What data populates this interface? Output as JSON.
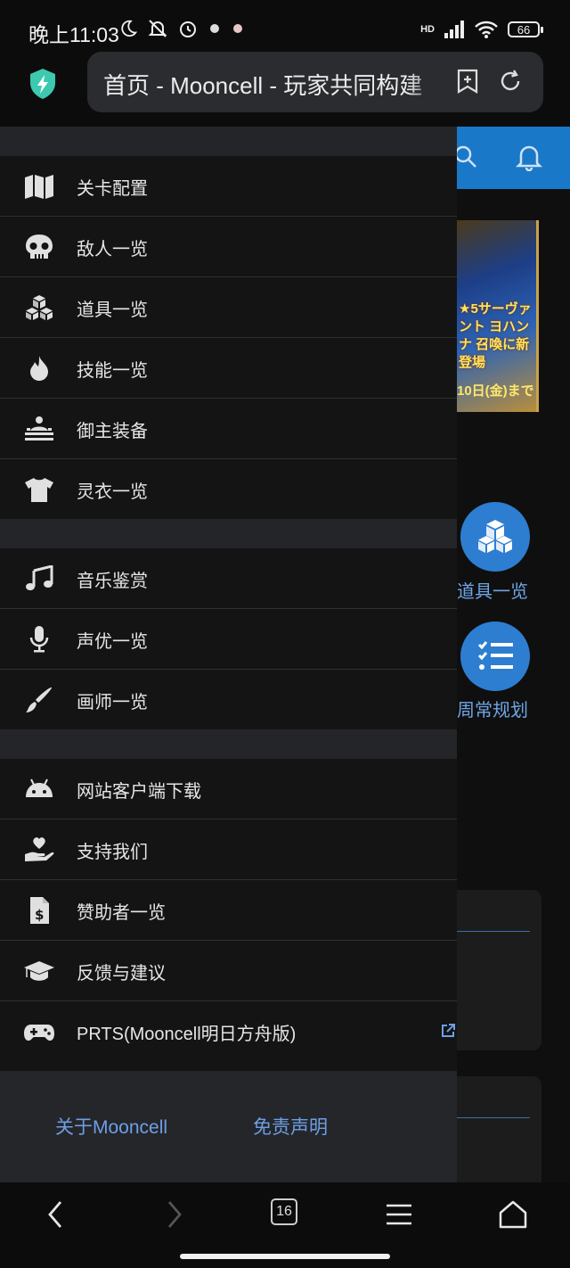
{
  "status_bar": {
    "time": "晚上11:03",
    "battery": "66",
    "network": "HD"
  },
  "address_bar": {
    "url_text": "首页 - Mooncell - 玩家共同构建"
  },
  "drawer": {
    "group1": [
      {
        "icon": "map-icon",
        "label": "关卡配置"
      },
      {
        "icon": "skull-icon",
        "label": "敌人一览"
      },
      {
        "icon": "cubes-icon",
        "label": "道具一览"
      },
      {
        "icon": "fire-icon",
        "label": "技能一览"
      },
      {
        "icon": "master-equip-icon",
        "label": "御主装备"
      },
      {
        "icon": "tshirt-icon",
        "label": "灵衣一览"
      }
    ],
    "group2": [
      {
        "icon": "music-icon",
        "label": "音乐鉴赏"
      },
      {
        "icon": "microphone-icon",
        "label": "声优一览"
      },
      {
        "icon": "paintbrush-icon",
        "label": "画师一览"
      }
    ],
    "group3": [
      {
        "icon": "android-icon",
        "label": "网站客户端下载"
      },
      {
        "icon": "hand-heart-icon",
        "label": "支持我们"
      },
      {
        "icon": "invoice-icon",
        "label": "赞助者一览"
      },
      {
        "icon": "graduation-cap-icon",
        "label": "反馈与建议"
      },
      {
        "icon": "gamepad-icon",
        "label": "PRTS(Mooncell明日方舟版)"
      }
    ],
    "footer": {
      "about": "关于Mooncell",
      "disclaimer": "免责声明"
    }
  },
  "background_page": {
    "banner_text": "★5サーヴァント ヨハンナ 召喚に新登場",
    "banner_date": "10日(金)まで",
    "shortcut1": "道具一览",
    "shortcut2": "周常规划"
  },
  "bottom_nav": {
    "tab_count": "16"
  },
  "colors": {
    "accent": "#1a78c9",
    "link": "#6d9fe6",
    "drawer_bg": "#141414",
    "gap_bg": "#242528"
  }
}
